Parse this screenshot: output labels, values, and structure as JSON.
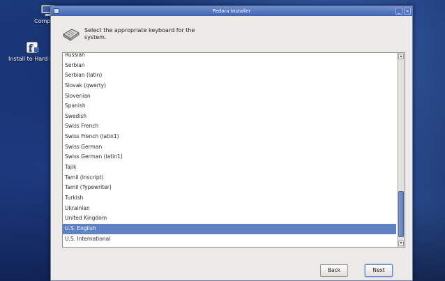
{
  "desktop": {
    "icons": [
      {
        "label": "Computer",
        "icon": "computer-icon"
      },
      {
        "label": "Install to Hard Drive",
        "icon": "install-icon"
      }
    ]
  },
  "window": {
    "title": "Fedora Installer"
  },
  "header": {
    "icon": "keyboard-icon",
    "prompt": "Select the appropriate keyboard for the system."
  },
  "keyboard_list": {
    "items": [
      "Russian",
      "Serbian",
      "Serbian (latin)",
      "Slovak (qwerty)",
      "Slovenian",
      "Spanish",
      "Swedish",
      "Swiss French",
      "Swiss French (latin1)",
      "Swiss German",
      "Swiss German (latin1)",
      "Tajik",
      "Tamil (Inscript)",
      "Tamil (Typewriter)",
      "Turkish",
      "Ukrainian",
      "United Kingdom",
      "U.S. English",
      "U.S. International"
    ],
    "selected": "U.S. English"
  },
  "buttons": {
    "back": "Back",
    "next": "Next"
  }
}
